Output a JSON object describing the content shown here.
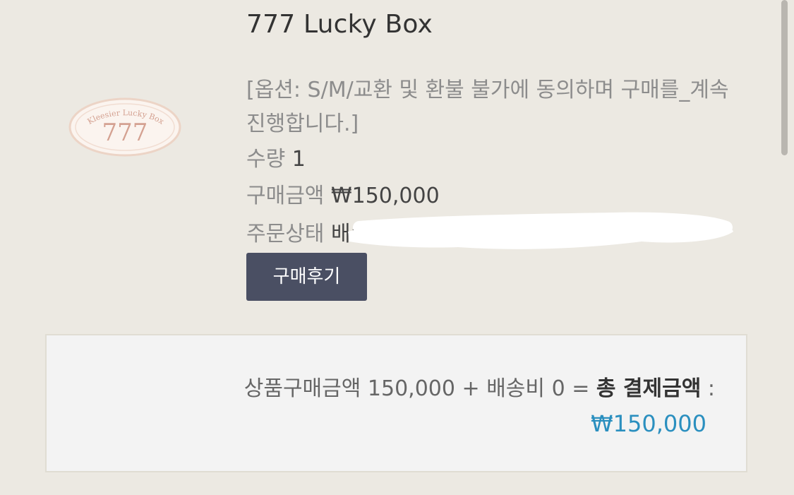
{
  "logo": {
    "arc_text": "Kleesier Lucky Box",
    "number": "777",
    "colors": {
      "ring": "#ecd4c6",
      "ink": "#d4a191",
      "fill": "#fbf4ef"
    }
  },
  "product": {
    "name": "777 Lucky Box",
    "option": "[옵션: S/M/교환 및 환불 불가에 동의하며 구매를_계속 진행합니다.]",
    "quantity_label": "수량",
    "quantity_value": "1",
    "amount_label": "구매금액",
    "amount_value": "₩150,000",
    "status_label": "주문상태",
    "status_value": "배송"
  },
  "review_button": "구매후기",
  "summary": {
    "goods_label": "상품구매금액",
    "goods_value": "150,000",
    "plus": "+",
    "shipping_label": "배송비",
    "shipping_value": "0",
    "equals": "=",
    "total_label": "총 결제금액",
    "colon": ":",
    "total_value": "₩150,000",
    "total_color": "#2a8fbf"
  }
}
